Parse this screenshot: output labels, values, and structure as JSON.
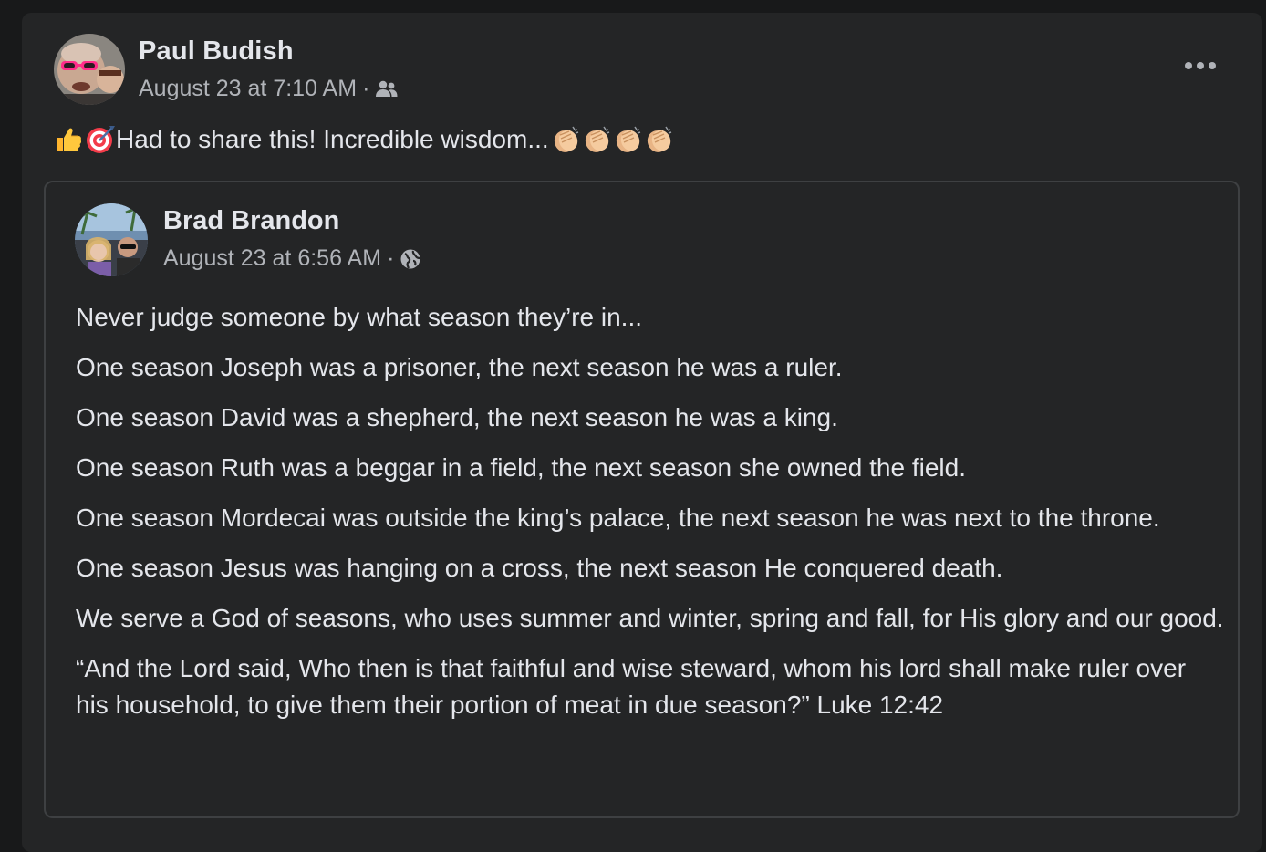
{
  "post": {
    "author_name": "Paul Budish",
    "timestamp": "August 23 at 7:10 AM",
    "audience_icon": "friends-icon",
    "more_icon": "more-options-icon",
    "text": "Had to share this! Incredible wisdom...",
    "leading_emojis": [
      "thumbs-up-icon",
      "direct-hit-icon"
    ],
    "trailing_emojis": [
      "clapping-hands-icon",
      "clapping-hands-icon",
      "clapping-hands-icon",
      "clapping-hands-icon"
    ]
  },
  "shared_post": {
    "author_name": "Brad Brandon",
    "timestamp": "August 23 at 6:56 AM",
    "audience_icon": "globe-icon",
    "paragraphs": [
      "Never judge someone by what season they’re in...",
      "One season Joseph was a prisoner, the next season he was a ruler.",
      "One season David was a shepherd, the next season he was a king.",
      "One season Ruth was a beggar in a field, the next season she owned the field.",
      "One season Mordecai was outside the king’s palace, the next season he was next to the throne.",
      "One season Jesus was hanging on a cross, the next season He conquered death.",
      "We serve a God of seasons, who uses summer and winter, spring and fall, for His glory and our good.",
      "“And the Lord said, Who then is that faithful and wise steward, whom his lord shall make ruler over his household, to give them their portion of meat in due season?” Luke 12:42"
    ]
  },
  "colors": {
    "page_background": "#18191a",
    "card_background": "#242526",
    "primary_text": "#e4e6eb",
    "secondary_text": "#b0b3b8",
    "border": "#3e4042"
  }
}
